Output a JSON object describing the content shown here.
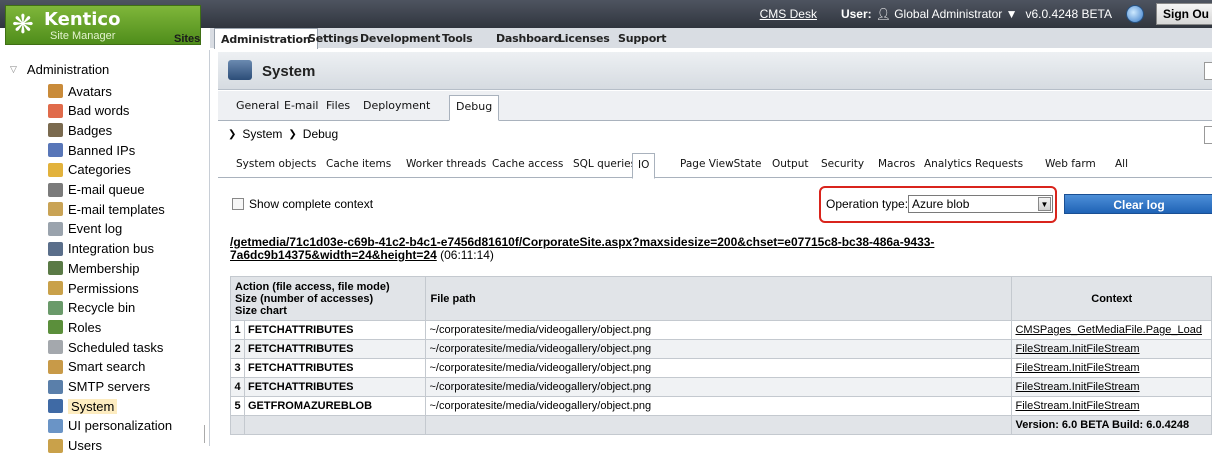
{
  "brand": {
    "name": "Kentico",
    "subtitle": "Site Manager",
    "sites_label": "Sites"
  },
  "topbar": {
    "cms_desk": "CMS Desk",
    "user_label": "User:",
    "user_name": "Global Administrator",
    "version": "v6.0.4248 BETA",
    "signout": "Sign Ou"
  },
  "menu": [
    "Administration",
    "Settings",
    "Development",
    "Tools",
    "Dashboard",
    "Licenses",
    "Support"
  ],
  "sidebar": {
    "root": "Administration",
    "items": [
      {
        "label": "Avatars",
        "icon": "avatar-icon",
        "color": "#c98b3a"
      },
      {
        "label": "Bad words",
        "icon": "bad-words-icon",
        "color": "#e06b4b"
      },
      {
        "label": "Badges",
        "icon": "badge-icon",
        "color": "#7a6a4f"
      },
      {
        "label": "Banned IPs",
        "icon": "banned-ip-icon",
        "color": "#5876b8"
      },
      {
        "label": "Categories",
        "icon": "categories-icon",
        "color": "#e2b23c"
      },
      {
        "label": "E-mail queue",
        "icon": "email-queue-icon",
        "color": "#7b7b7b"
      },
      {
        "label": "E-mail templates",
        "icon": "email-templates-icon",
        "color": "#c9a355"
      },
      {
        "label": "Event log",
        "icon": "event-log-icon",
        "color": "#9aa3ad"
      },
      {
        "label": "Integration bus",
        "icon": "integration-bus-icon",
        "color": "#5a6e8a"
      },
      {
        "label": "Membership",
        "icon": "membership-icon",
        "color": "#5a7a46"
      },
      {
        "label": "Permissions",
        "icon": "permissions-icon",
        "color": "#c9a14a"
      },
      {
        "label": "Recycle bin",
        "icon": "recycle-bin-icon",
        "color": "#6a9a6a"
      },
      {
        "label": "Roles",
        "icon": "roles-icon",
        "color": "#5b8f3b"
      },
      {
        "label": "Scheduled tasks",
        "icon": "clock-icon",
        "color": "#a4a8ad"
      },
      {
        "label": "Smart search",
        "icon": "smart-search-icon",
        "color": "#c89a48"
      },
      {
        "label": "SMTP servers",
        "icon": "smtp-servers-icon",
        "color": "#5a7faa"
      },
      {
        "label": "System",
        "icon": "system-icon",
        "color": "#3f6aa5",
        "selected": true
      },
      {
        "label": "UI personalization",
        "icon": "ui-personalization-icon",
        "color": "#6a94c6"
      },
      {
        "label": "Users",
        "icon": "users-icon",
        "color": "#c9a14a"
      }
    ]
  },
  "page": {
    "title": "System"
  },
  "tabs1": [
    "General",
    "E-mail",
    "Files",
    "Deployment",
    "Debug"
  ],
  "breadcrumb": [
    "System",
    "Debug"
  ],
  "tabs2": [
    "System objects",
    "Cache items",
    "Worker threads",
    "Cache access",
    "SQL queries",
    "IO",
    "Page ViewState",
    "Output",
    "Security",
    "Macros",
    "Analytics",
    "Requests",
    "Web farm",
    "All"
  ],
  "controls": {
    "show_context": "Show complete context",
    "op_label": "Operation type:",
    "op_value": "Azure blob",
    "clear": "Clear log"
  },
  "request": {
    "url_line1": "/getmedia/71c1d03e-c69b-41c2-b4c1-e7456d81610f/CorporateSite.aspx?maxsidesize=200&chset=e07715c8-bc38-486a-9433-",
    "url_line2": "7a6dc9b14375&width=24&height=24",
    "time": "(06:11:14)"
  },
  "table": {
    "headers": {
      "action": [
        "Action (file access, file mode)",
        "Size (number of accesses)",
        "Size chart"
      ],
      "path": "File path",
      "context": "Context"
    },
    "rows": [
      {
        "n": "1",
        "action": "FETCHATTRIBUTES",
        "path": "~/corporatesite/media/videogallery/object.png",
        "context": "CMSPages_GetMediaFile.Page_Load"
      },
      {
        "n": "2",
        "action": "FETCHATTRIBUTES",
        "path": "~/corporatesite/media/videogallery/object.png",
        "context": "FileStream.InitFileStream"
      },
      {
        "n": "3",
        "action": "FETCHATTRIBUTES",
        "path": "~/corporatesite/media/videogallery/object.png",
        "context": "FileStream.InitFileStream"
      },
      {
        "n": "4",
        "action": "FETCHATTRIBUTES",
        "path": "~/corporatesite/media/videogallery/object.png",
        "context": "FileStream.InitFileStream"
      },
      {
        "n": "5",
        "action": "GETFROMAZUREBLOB",
        "path": "~/corporatesite/media/videogallery/object.png",
        "context": "FileStream.InitFileStream"
      }
    ],
    "footer": "Version: 6.0 BETA Build: 6.0.4248"
  }
}
